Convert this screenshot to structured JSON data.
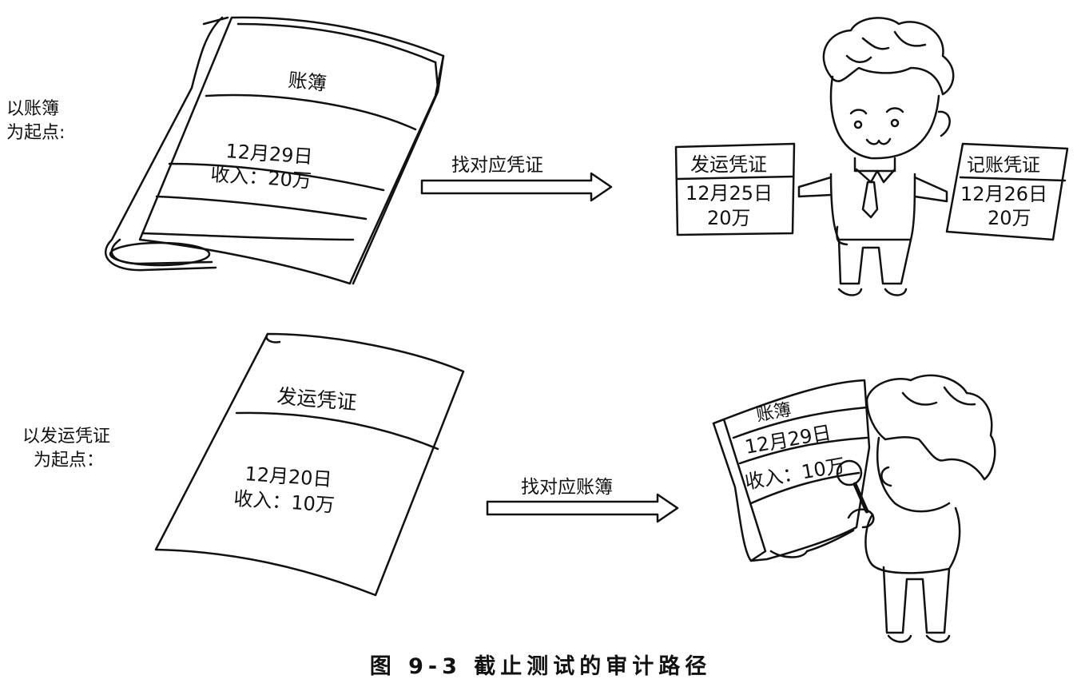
{
  "row1": {
    "start_label_line1": "以账簿",
    "start_label_line2": "为起点:",
    "ledger": {
      "title": "账簿",
      "date": "12月29日",
      "amount": "收入：20万"
    },
    "arrow_label": "找对应凭证",
    "shipping_voucher": {
      "title": "发运凭证",
      "date": "12月25日",
      "amount": "20万"
    },
    "accounting_voucher": {
      "title": "记账凭证",
      "date": "12月26日",
      "amount": "20万"
    }
  },
  "row2": {
    "start_label_line1": "以发运凭证",
    "start_label_line2": "为起点：",
    "voucher": {
      "title": "发运凭证",
      "date": "12月20日",
      "amount": "收入：10万"
    },
    "arrow_label": "找对应账簿",
    "ledger": {
      "title": "账簿",
      "date": "12月29日",
      "amount": "收入：10万"
    }
  },
  "caption": "图 9-3  截止测试的审计路径"
}
